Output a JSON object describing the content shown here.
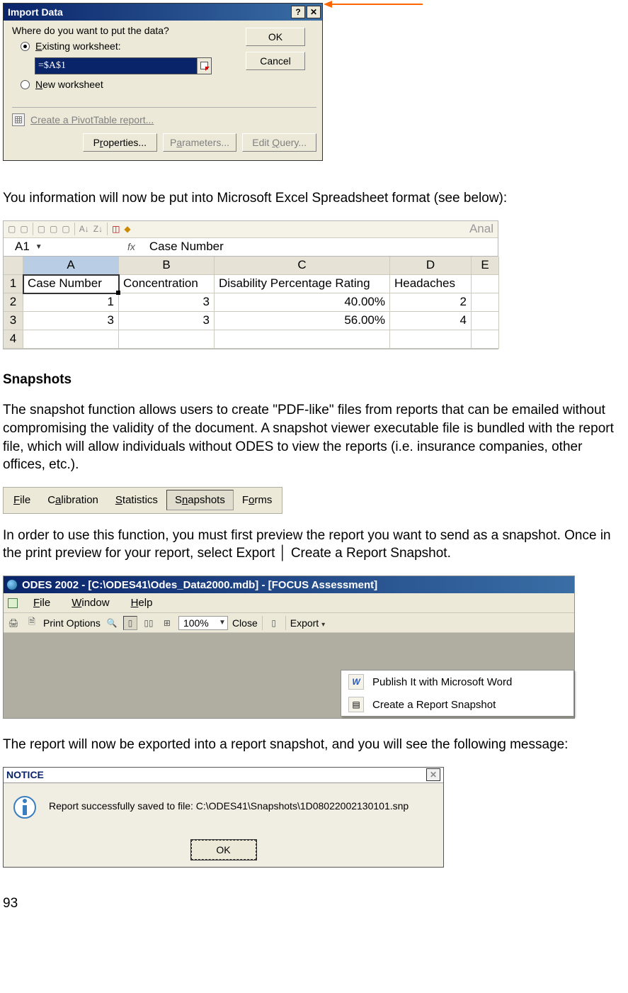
{
  "import_dialog": {
    "title": "Import Data",
    "help_glyph": "?",
    "close_glyph": "✕",
    "prompt": "Where do you want to put the data?",
    "opt_existing": {
      "pre": "",
      "ul": "E",
      "post": "xisting worksheet:"
    },
    "cell_ref_value": "=$A$1",
    "opt_new": {
      "pre": "",
      "ul": "N",
      "post": "ew worksheet"
    },
    "ok_label": "OK",
    "cancel_label": "Cancel",
    "pivot_link": "Create a PivotTable report...",
    "properties": {
      "pre": "P",
      "ul": "r",
      "post": "operties..."
    },
    "parameters": {
      "pre": "P",
      "ul": "a",
      "post": "rameters..."
    },
    "edit_query": {
      "pre": "Edit ",
      "ul": "Q",
      "post": "uery..."
    }
  },
  "para1": "You information will now be put into Microsoft Excel Spreadsheet format (see below):",
  "excel": {
    "toolbar_anal": "Anal",
    "name_box": "A1",
    "fx_label": "fx",
    "fx_value": "Case Number",
    "col_labels": [
      "A",
      "B",
      "C",
      "D",
      "E"
    ],
    "row_labels": [
      "1",
      "2",
      "3",
      "4"
    ],
    "headers": [
      "Case Number",
      "Concentration",
      "Disability Percentage Rating",
      "Headaches",
      ""
    ],
    "rows": [
      [
        "1",
        "3",
        "40.00%",
        "2",
        ""
      ],
      [
        "3",
        "3",
        "56.00%",
        "4",
        ""
      ],
      [
        "",
        "",
        "",
        "",
        ""
      ]
    ]
  },
  "heading_snapshots": "Snapshots",
  "para2": "The snapshot function allows users to create \"PDF-like\" files from reports that can be emailed without compromising the validity of the document.  A snapshot viewer executable file is bundled with the report file, which will allow individuals without ODES to view the reports (i.e. insurance companies, other offices, etc.).",
  "menubar": {
    "items": [
      {
        "pre": "",
        "ul": "F",
        "post": "ile"
      },
      {
        "pre": "C",
        "ul": "a",
        "post": "libration"
      },
      {
        "pre": "",
        "ul": "S",
        "post": "tatistics"
      },
      {
        "pre": "S",
        "ul": "n",
        "post": "apshots"
      },
      {
        "pre": "F",
        "ul": "o",
        "post": "rms"
      }
    ],
    "pressed_index": 3
  },
  "para3": "In order to use this function, you must first preview the report you want to send as a snapshot.  Once in the print preview for your report, select Export │ Create a Report Snapshot.",
  "odes": {
    "title": "ODES 2002 - [C:\\ODES41\\Odes_Data2000.mdb] - [FOCUS Assessment]",
    "menu": [
      {
        "pre": "",
        "ul": "F",
        "post": "ile"
      },
      {
        "pre": "",
        "ul": "W",
        "post": "indow"
      },
      {
        "pre": "",
        "ul": "H",
        "post": "elp"
      }
    ],
    "toolbar": {
      "print_options": "Print Options",
      "zoom": "100%",
      "close": "Close",
      "export": "Export"
    },
    "dropdown": {
      "word_label": "Publish It with Microsoft Word",
      "word_icon": "W",
      "snapshot_label": "Create a Report Snapshot"
    }
  },
  "para4": "The report will now be exported into a report snapshot, and you will see the following message:",
  "notice": {
    "title": "NOTICE",
    "close_glyph": "✕",
    "message": "Report successfully saved to file: C:\\ODES41\\Snapshots\\1D08022002130101.snp",
    "ok_label": "OK"
  },
  "page_number": "93"
}
